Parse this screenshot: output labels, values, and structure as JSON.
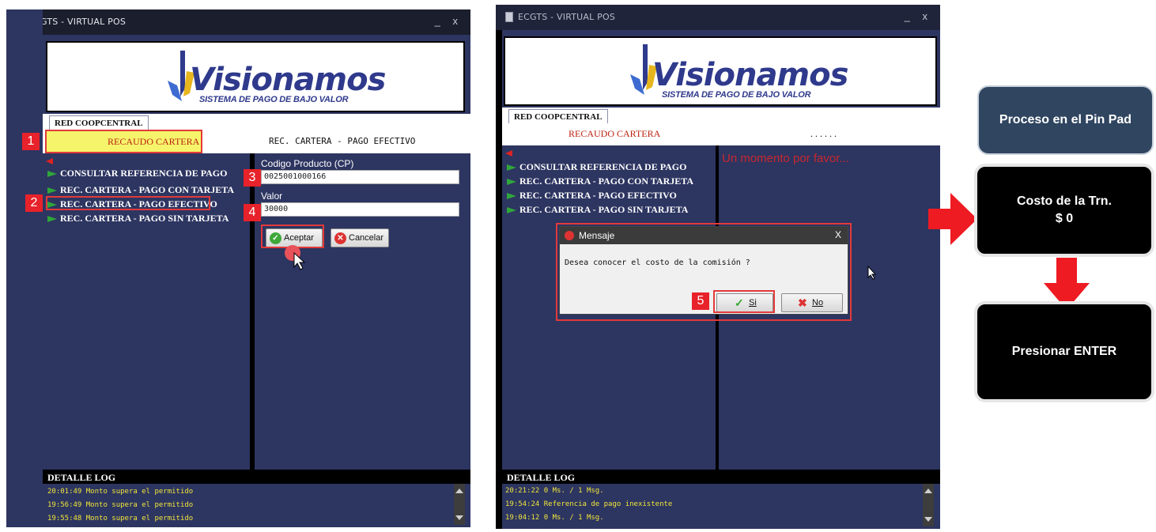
{
  "left_window": {
    "title": "ECGTS - VIRTUAL POS",
    "window_controls": "_  x",
    "logo": {
      "brand": "Visionamos",
      "tagline": "SISTEMA DE PAGO DE BAJO VALOR"
    },
    "tab": "RED COOPCENTRAL",
    "status_left": "RECAUDO CARTERA",
    "status_right": "REC. CARTERA - PAGO EFECTIVO",
    "menu_items": [
      "CONSULTAR REFERENCIA DE PAGO",
      "REC. CARTERA - PAGO CON TARJETA",
      "REC. CARTERA - PAGO EFECTIVO",
      "REC. CARTERA - PAGO SIN TARJETA"
    ],
    "form": {
      "product_label": "Codigo Producto (CP)",
      "product_value": "0025001000166",
      "value_label": "Valor",
      "value_value": "30000"
    },
    "buttons": {
      "accept": "Aceptar",
      "cancel": "Cancelar"
    },
    "log_title": "DETALLE LOG",
    "log_lines": [
      "20:01:49 Monto supera el permitido",
      "19:56:49 Monto supera el permitido",
      "19:55:48 Monto supera el permitido"
    ],
    "steps": [
      "1",
      "2",
      "3",
      "4"
    ]
  },
  "right_window": {
    "title": "ECGTS - VIRTUAL POS",
    "window_controls": "_  x",
    "logo": {
      "brand": "Visionamos",
      "tagline": "SISTEMA DE PAGO DE BAJO VALOR"
    },
    "tab": "RED COOPCENTRAL",
    "status_left": "RECAUDO CARTERA",
    "status_right": "......",
    "menu_items": [
      "CONSULTAR REFERENCIA DE PAGO",
      "REC. CARTERA - PAGO CON TARJETA",
      "REC. CARTERA - PAGO EFECTIVO",
      "REC. CARTERA - PAGO SIN TARJETA"
    ],
    "wait_message": "Un momento por favor...",
    "dialog": {
      "title": "Mensaje",
      "close": "X",
      "message": "Desea conocer el costo de la comisión ?",
      "yes": "Si",
      "no": "No"
    },
    "log_title": "DETALLE LOG",
    "log_lines": [
      "20:21:22 0 Ms. / 1 Msg.",
      "19:54:24 Referencia de pago inexistente",
      "19:04:12 0 Ms. / 1 Msg."
    ],
    "steps": [
      "5"
    ]
  },
  "flow": {
    "pin_pad": "Proceso en el Pin Pad",
    "cost_line1": "Costo de la Trn.",
    "cost_line2": "$ 0",
    "enter": "Presionar ENTER"
  },
  "colors": {
    "panel_blue": "#2d3561",
    "highlight_red": "#e8222a",
    "log_yellow": "#f0e53b",
    "flow_header": "#2f4560",
    "flow_box": "#000000"
  }
}
